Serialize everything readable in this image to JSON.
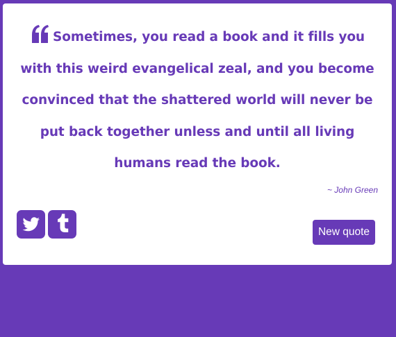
{
  "quote": {
    "text": "Sometimes, you read a book and it fills you with this weird evangelical zeal, and you become convinced that the shattered world will never be put back together unless and until all living humans read the book.",
    "author": "~ John Green"
  },
  "actions": {
    "new_quote_label": "New quote",
    "share_icons": [
      "twitter-icon",
      "tumblr-icon"
    ]
  },
  "colors": {
    "accent": "#673ab7",
    "card": "#ffffff"
  }
}
